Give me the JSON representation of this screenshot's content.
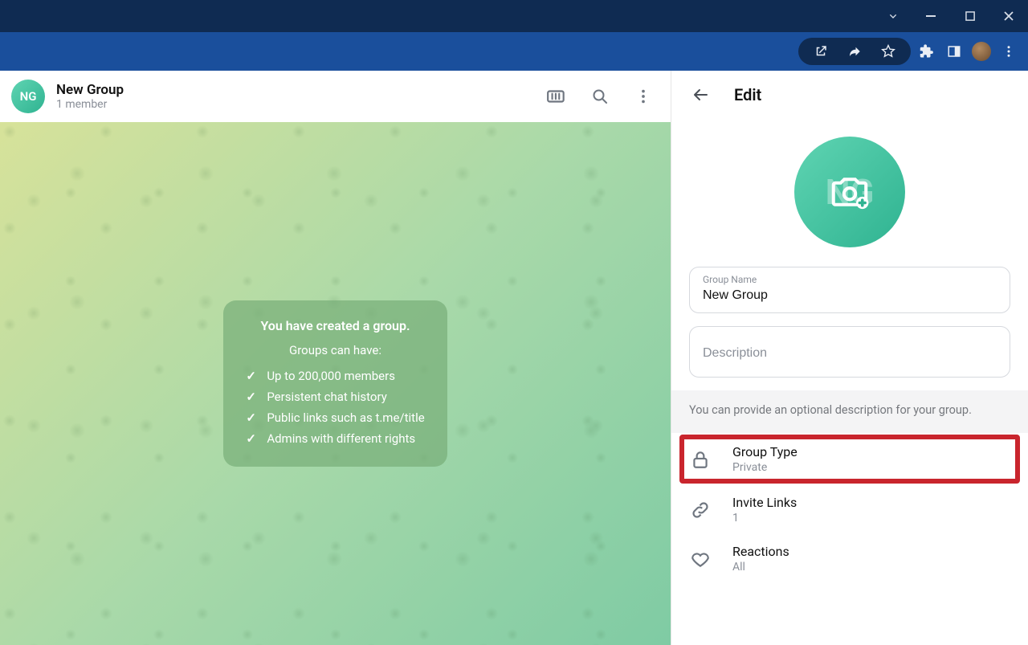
{
  "chat": {
    "avatar_initials": "NG",
    "title": "New Group",
    "subtitle": "1 member"
  },
  "center_card": {
    "title": "You have created a group.",
    "subtitle": "Groups can have:",
    "items": [
      "Up to 200,000 members",
      "Persistent chat history",
      "Public links such as t.me/title",
      "Admins with different rights"
    ]
  },
  "edit": {
    "title": "Edit",
    "photo_initials": "NG",
    "group_name_label": "Group Name",
    "group_name_value": "New Group",
    "description_placeholder": "Description",
    "hint": "You can provide an optional description for your group.",
    "rows": {
      "group_type": {
        "title": "Group Type",
        "value": "Private"
      },
      "invite_links": {
        "title": "Invite Links",
        "value": "1"
      },
      "reactions": {
        "title": "Reactions",
        "value": "All"
      }
    }
  }
}
